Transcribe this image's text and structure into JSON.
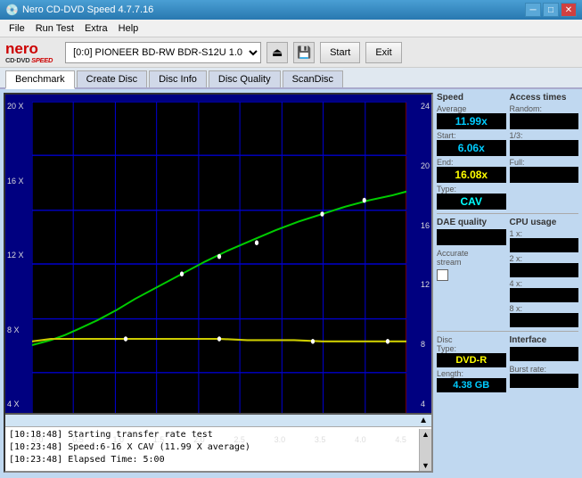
{
  "titleBar": {
    "title": "Nero CD-DVD Speed 4.7.7.16",
    "minimize": "─",
    "maximize": "□",
    "close": "✕"
  },
  "menuBar": {
    "items": [
      "File",
      "Run Test",
      "Extra",
      "Help"
    ]
  },
  "toolbar": {
    "drive": "[0:0]  PIONEER BD-RW  BDR-S12U 1.00",
    "startLabel": "Start",
    "exitLabel": "Exit"
  },
  "tabs": [
    "Benchmark",
    "Create Disc",
    "Disc Info",
    "Disc Quality",
    "ScanDisc"
  ],
  "activeTab": "Benchmark",
  "speedPanel": {
    "title": "Speed",
    "averageLabel": "Average",
    "averageValue": "11.99x",
    "startLabel": "Start:",
    "startValue": "6.06x",
    "endLabel": "End:",
    "endValue": "16.08x",
    "typeLabel": "Type:",
    "typeValue": "CAV"
  },
  "daePanel": {
    "title": "DAE quality",
    "value": "",
    "accurateLabel": "Accurate",
    "streamLabel": "stream"
  },
  "discPanel": {
    "typeLabel": "Disc",
    "typeSub": "Type:",
    "typeValue": "DVD-R",
    "lengthLabel": "Length:",
    "lengthValue": "4.38 GB"
  },
  "accessPanel": {
    "title": "Access times",
    "randomLabel": "Random:",
    "randomValue": "",
    "oneThirdLabel": "1/3:",
    "oneThirdValue": "",
    "fullLabel": "Full:",
    "fullValue": "",
    "cpuLabel": "CPU usage",
    "cpu1xLabel": "1 x:",
    "cpu1xValue": "",
    "cpu2xLabel": "2 x:",
    "cpu2xValue": "",
    "cpu4xLabel": "4 x:",
    "cpu4xValue": "",
    "cpu8xLabel": "8 x:",
    "cpu8xValue": "",
    "interfaceLabel": "Interface",
    "burstLabel": "Burst rate:",
    "burstValue": ""
  },
  "chart": {
    "yLabelsRight": [
      "24",
      "20",
      "16",
      "12",
      "8",
      "4"
    ],
    "yLabelsLeft": [
      "20 X",
      "16 X",
      "12 X",
      "8 X",
      "4 X"
    ],
    "xLabels": [
      "0.0",
      "0.5",
      "1.0",
      "1.5",
      "2.0",
      "2.5",
      "3.0",
      "3.5",
      "4.0",
      "4.5"
    ]
  },
  "log": {
    "entries": [
      "[10:18:48]  Starting transfer rate test",
      "[10:23:48]  Speed:6-16 X CAV (11.99 X average)",
      "[10:23:48]  Elapsed Time: 5:00"
    ]
  }
}
